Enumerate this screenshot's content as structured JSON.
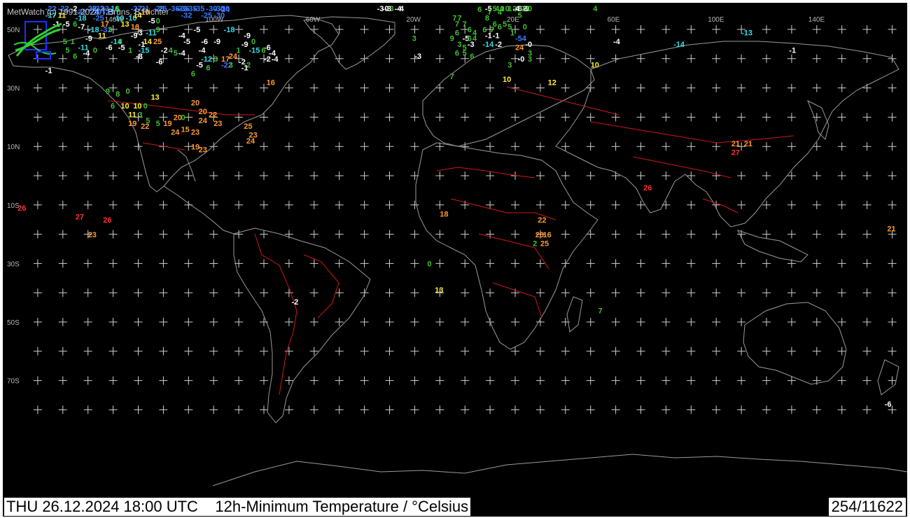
{
  "credit": "MetWatch  (c) 1991-2024 T.Bruns, B.Richter",
  "footer": {
    "left": "THU 26.12.2024 18:00 UTC    12h-Minimum Temperature / °Celsius",
    "right": "254/11622"
  },
  "lon_labels": [
    "140W",
    "100W",
    "60W",
    "20W",
    "20E",
    "60E",
    "100E",
    "140E"
  ],
  "lat_labels": [
    "50N",
    "30N",
    "10N",
    "10S",
    "30S",
    "50S",
    "70S"
  ],
  "colors": {
    "very_cold": "#3a7aff",
    "cold": "#33dde8",
    "freezing": "#ffffff",
    "cool": "#40c030",
    "mild": "#ffee33",
    "warm": "#ff9a30",
    "hot": "#ff3030"
  },
  "observations": [
    {
      "v": "-30",
      "lon": -98,
      "lat": 65
    },
    {
      "v": "-36",
      "lon": -114,
      "lat": 63
    },
    {
      "v": "-32",
      "lon": -115,
      "lat": 60
    },
    {
      "v": "-35",
      "lon": -111,
      "lat": 60
    },
    {
      "v": "-21",
      "lon": -130,
      "lat": 64
    },
    {
      "v": "-25",
      "lon": -123,
      "lat": 63
    },
    {
      "v": "-32",
      "lon": -148,
      "lat": 62
    },
    {
      "v": "-25",
      "lon": -151,
      "lat": 60
    },
    {
      "v": "-23",
      "lon": -146,
      "lat": 59
    },
    {
      "v": "-30",
      "lon": -103,
      "lat": 58
    },
    {
      "v": "-22",
      "lon": -167,
      "lat": 58
    },
    {
      "v": "-22",
      "lon": -162,
      "lat": 59
    },
    {
      "v": "-2",
      "lon": -157,
      "lat": 59
    },
    {
      "v": "-22",
      "lon": -151,
      "lat": 58
    },
    {
      "v": "-16",
      "lon": -142,
      "lat": 57
    },
    {
      "v": "-27",
      "lon": -133,
      "lat": 58
    },
    {
      "v": "-29",
      "lon": -124,
      "lat": 58
    },
    {
      "v": "-36",
      "lon": -118,
      "lat": 58
    },
    {
      "v": "-35",
      "lon": -108,
      "lat": 58
    },
    {
      "v": "-24",
      "lon": -98,
      "lat": 56
    },
    {
      "v": "-32",
      "lon": -155,
      "lat": 55
    },
    {
      "v": "-29",
      "lon": -149,
      "lat": 55
    },
    {
      "v": "-25",
      "lon": -144,
      "lat": 55
    },
    {
      "v": "5",
      "lon": -139,
      "lat": 56
    },
    {
      "v": "19",
      "lon": -129,
      "lat": 55
    },
    {
      "v": "-32",
      "lon": -113,
      "lat": 54
    },
    {
      "v": "-25",
      "lon": -105,
      "lat": 54
    },
    {
      "v": "-30",
      "lon": -100,
      "lat": 54
    },
    {
      "v": "-17",
      "lon": -167,
      "lat": 54
    },
    {
      "v": "11",
      "lon": -162,
      "lat": 54
    },
    {
      "v": "-18",
      "lon": -155,
      "lat": 53
    },
    {
      "v": "-25",
      "lon": -148,
      "lat": 53
    },
    {
      "v": "-10",
      "lon": -140,
      "lat": 53
    },
    {
      "v": "-10",
      "lon": -135,
      "lat": 53
    },
    {
      "v": "14",
      "lon": -132,
      "lat": 54
    },
    {
      "v": "-1",
      "lon": -164,
      "lat": 51
    },
    {
      "v": "-5",
      "lon": -160,
      "lat": 51
    },
    {
      "v": "6",
      "lon": -156,
      "lat": 51
    },
    {
      "v": "-7",
      "lon": -154,
      "lat": 50
    },
    {
      "v": "17",
      "lon": -145,
      "lat": 51
    },
    {
      "v": "13",
      "lon": -137,
      "lat": 51
    },
    {
      "v": "16",
      "lon": -133,
      "lat": 50
    },
    {
      "v": "-5",
      "lon": -126,
      "lat": 52
    },
    {
      "v": "0",
      "lon": -123,
      "lat": 52
    },
    {
      "v": "-18",
      "lon": -150,
      "lat": 49
    },
    {
      "v": "-31",
      "lon": -145,
      "lat": 49
    },
    {
      "v": "3",
      "lon": -142,
      "lat": 49
    },
    {
      "v": "-3",
      "lon": -131,
      "lat": 48
    },
    {
      "v": "-11",
      "lon": -127,
      "lat": 48
    },
    {
      "v": "9",
      "lon": -123,
      "lat": 49
    },
    {
      "v": "-5",
      "lon": -108,
      "lat": 49
    },
    {
      "v": "-18",
      "lon": -96,
      "lat": 49
    },
    {
      "v": "-9",
      "lon": -88,
      "lat": 47
    },
    {
      "v": "0",
      "lon": -85,
      "lat": 45
    },
    {
      "v": "-4",
      "lon": -114,
      "lat": 47
    },
    {
      "v": "5",
      "lon": -160,
      "lat": 45
    },
    {
      "v": "1",
      "lon": -157,
      "lat": 45
    },
    {
      "v": "-9",
      "lon": -151,
      "lat": 46
    },
    {
      "v": "11",
      "lon": -146,
      "lat": 47
    },
    {
      "v": "-14",
      "lon": -141,
      "lat": 45
    },
    {
      "v": "8",
      "lon": -138,
      "lat": 45
    },
    {
      "v": "-9",
      "lon": -133,
      "lat": 47
    },
    {
      "v": "14",
      "lon": -128,
      "lat": 45
    },
    {
      "v": "25",
      "lon": -124,
      "lat": 45
    },
    {
      "v": "-1",
      "lon": -130,
      "lat": 44
    },
    {
      "v": "-5",
      "lon": -112,
      "lat": 45
    },
    {
      "v": "-6",
      "lon": -105,
      "lat": 45
    },
    {
      "v": "-9",
      "lon": -100,
      "lat": 45
    },
    {
      "v": "-9",
      "lon": -89,
      "lat": 44
    },
    {
      "v": "-6",
      "lon": -80,
      "lat": 43
    },
    {
      "v": "5",
      "lon": -159,
      "lat": 42
    },
    {
      "v": "-11",
      "lon": -154,
      "lat": 43
    },
    {
      "v": "0",
      "lon": -148,
      "lat": 42
    },
    {
      "v": "-6",
      "lon": -143,
      "lat": 43
    },
    {
      "v": "-5",
      "lon": -138,
      "lat": 43
    },
    {
      "v": "1",
      "lon": -134,
      "lat": 42
    },
    {
      "v": "-15",
      "lon": -130,
      "lat": 42
    },
    {
      "v": "-2",
      "lon": -121,
      "lat": 42
    },
    {
      "v": "4",
      "lon": -118,
      "lat": 42
    },
    {
      "v": "5",
      "lon": -116,
      "lat": 41
    },
    {
      "v": "-4",
      "lon": -114,
      "lat": 41
    },
    {
      "v": "-4",
      "lon": -106,
      "lat": 42
    },
    {
      "v": "1",
      "lon": -91,
      "lat": 42
    },
    {
      "v": "-15",
      "lon": -86,
      "lat": 42
    },
    {
      "v": "6",
      "lon": -81,
      "lat": 42
    },
    {
      "v": "-4",
      "lon": -78,
      "lat": 41
    },
    {
      "v": "6",
      "lon": -156,
      "lat": 40
    },
    {
      "v": "-4",
      "lon": -152,
      "lat": 41
    },
    {
      "v": "-8",
      "lon": -131,
      "lat": 40
    },
    {
      "v": "-6",
      "lon": -123,
      "lat": 38
    },
    {
      "v": "-12",
      "lon": -105,
      "lat": 39
    },
    {
      "v": "3",
      "lon": -100,
      "lat": 39
    },
    {
      "v": "17",
      "lon": -97,
      "lat": 39
    },
    {
      "v": "24",
      "lon": -94,
      "lat": 40
    },
    {
      "v": "-2",
      "lon": -90,
      "lat": 38
    },
    {
      "v": "2",
      "lon": -87,
      "lat": 37
    },
    {
      "v": "-2",
      "lon": -80,
      "lat": 39
    },
    {
      "v": "-4",
      "lon": -77,
      "lat": 39
    },
    {
      "v": "-5",
      "lon": -107,
      "lat": 37
    },
    {
      "v": "6",
      "lon": -103,
      "lat": 36
    },
    {
      "v": "-22",
      "lon": -97,
      "lat": 37
    },
    {
      "v": "3",
      "lon": -94,
      "lat": 37
    },
    {
      "v": "-1",
      "lon": -89,
      "lat": 36
    },
    {
      "v": "6",
      "lon": -109,
      "lat": 34
    },
    {
      "v": "-1",
      "lon": -167,
      "lat": 35
    },
    {
      "v": "9",
      "lon": -143,
      "lat": 28
    },
    {
      "v": "8",
      "lon": -139,
      "lat": 27
    },
    {
      "v": "0",
      "lon": -135,
      "lat": 28
    },
    {
      "v": "13",
      "lon": -125,
      "lat": 26
    },
    {
      "v": "6",
      "lon": -141,
      "lat": 23
    },
    {
      "v": "10",
      "lon": -137,
      "lat": 23
    },
    {
      "v": "10",
      "lon": -132,
      "lat": 23
    },
    {
      "v": "0",
      "lon": -128,
      "lat": 23
    },
    {
      "v": "11",
      "lon": -134,
      "lat": 20
    },
    {
      "v": "3",
      "lon": -130,
      "lat": 20
    },
    {
      "v": "19",
      "lon": -134,
      "lat": 17
    },
    {
      "v": "5",
      "lon": -127,
      "lat": 18
    },
    {
      "v": "22",
      "lon": -129,
      "lat": 16
    },
    {
      "v": "5",
      "lon": -123,
      "lat": 17
    },
    {
      "v": "19",
      "lon": -120,
      "lat": 17
    },
    {
      "v": "20",
      "lon": -116,
      "lat": 19
    },
    {
      "v": "0",
      "lon": -113,
      "lat": 19
    },
    {
      "v": "24",
      "lon": -117,
      "lat": 14
    },
    {
      "v": "15",
      "lon": -113,
      "lat": 15
    },
    {
      "v": "23",
      "lon": -109,
      "lat": 14
    },
    {
      "v": "20",
      "lon": -109,
      "lat": 24
    },
    {
      "v": "20",
      "lon": -106,
      "lat": 21
    },
    {
      "v": "22",
      "lon": -102,
      "lat": 20
    },
    {
      "v": "24",
      "lon": -106,
      "lat": 18
    },
    {
      "v": "23",
      "lon": -100,
      "lat": 17
    },
    {
      "v": "25",
      "lon": -88,
      "lat": 16
    },
    {
      "v": "23",
      "lon": -86,
      "lat": 13
    },
    {
      "v": "24",
      "lon": -87,
      "lat": 11
    },
    {
      "v": "19",
      "lon": -109,
      "lat": 9
    },
    {
      "v": "23",
      "lon": -106,
      "lat": 8
    },
    {
      "v": "16",
      "lon": -79,
      "lat": 31
    },
    {
      "v": "26",
      "lon": -178,
      "lat": -12
    },
    {
      "v": "27",
      "lon": -155,
      "lat": -15
    },
    {
      "v": "26",
      "lon": -144,
      "lat": -16
    },
    {
      "v": "23",
      "lon": -150,
      "lat": -21
    },
    {
      "v": "-2",
      "lon": -69,
      "lat": -44
    },
    {
      "v": "-4",
      "lon": -27,
      "lat": 65
    },
    {
      "v": "-0",
      "lon": -33,
      "lat": 59
    },
    {
      "v": "3",
      "lon": -30,
      "lat": 59
    },
    {
      "v": "-4",
      "lon": -28,
      "lat": 59
    },
    {
      "v": "-3",
      "lon": -35,
      "lat": 72
    },
    {
      "v": "-3",
      "lon": -32,
      "lat": 72
    },
    {
      "v": "-2",
      "lon": 23,
      "lat": 70
    },
    {
      "v": "-6",
      "lon": 20,
      "lat": 68
    },
    {
      "v": "4",
      "lon": 51,
      "lat": 72
    },
    {
      "v": "1",
      "lon": 14,
      "lat": 63
    },
    {
      "v": "0",
      "lon": 16,
      "lat": 63
    },
    {
      "v": "-4",
      "lon": 19,
      "lat": 63
    },
    {
      "v": "-3",
      "lon": 22,
      "lat": 62
    },
    {
      "v": "3",
      "lon": 24,
      "lat": 62
    },
    {
      "v": "0",
      "lon": 25,
      "lat": 64
    },
    {
      "v": "4",
      "lon": 12,
      "lat": 60
    },
    {
      "v": "0",
      "lon": 14,
      "lat": 60
    },
    {
      "v": "1",
      "lon": 17,
      "lat": 59
    },
    {
      "v": "-0",
      "lon": 23,
      "lat": 59
    },
    {
      "v": "4",
      "lon": 24,
      "lat": 59
    },
    {
      "v": "-5",
      "lon": 8,
      "lat": 58
    },
    {
      "v": "5",
      "lon": 11,
      "lat": 58
    },
    {
      "v": "6",
      "lon": 5,
      "lat": 56
    },
    {
      "v": "7",
      "lon": 9,
      "lat": 55
    },
    {
      "v": "4",
      "lon": 13,
      "lat": 55
    },
    {
      "v": "2",
      "lon": 19,
      "lat": 57
    },
    {
      "v": "0",
      "lon": 22,
      "lat": 57
    },
    {
      "v": "5",
      "lon": 21,
      "lat": 54
    },
    {
      "v": "7",
      "lon": -5,
      "lat": 53
    },
    {
      "v": "7",
      "lon": -3,
      "lat": 53
    },
    {
      "v": "8",
      "lon": 8,
      "lat": 53
    },
    {
      "v": "6",
      "lon": 11,
      "lat": 51
    },
    {
      "v": "5",
      "lon": 15,
      "lat": 51
    },
    {
      "v": "7",
      "lon": -4,
      "lat": 51
    },
    {
      "v": "7",
      "lon": -1,
      "lat": 51
    },
    {
      "v": "6",
      "lon": 1,
      "lat": 49
    },
    {
      "v": "6",
      "lon": -4,
      "lat": 48
    },
    {
      "v": "4",
      "lon": 3,
      "lat": 48
    },
    {
      "v": "-1",
      "lon": 8,
      "lat": 47
    },
    {
      "v": "-1",
      "lon": 11,
      "lat": 47
    },
    {
      "v": "6",
      "lon": 7,
      "lat": 49
    },
    {
      "v": "7",
      "lon": 10,
      "lat": 49
    },
    {
      "v": "6",
      "lon": 13,
      "lat": 50
    },
    {
      "v": "5",
      "lon": 17,
      "lat": 50
    },
    {
      "v": "1",
      "lon": 18,
      "lat": 48
    },
    {
      "v": "0",
      "lon": 23,
      "lat": 50
    },
    {
      "v": "9",
      "lon": -6,
      "lat": 46
    },
    {
      "v": "-5",
      "lon": -1,
      "lat": 46
    },
    {
      "v": "6",
      "lon": 1,
      "lat": 46
    },
    {
      "v": "4",
      "lon": 3,
      "lat": 46
    },
    {
      "v": "-3",
      "lon": 1,
      "lat": 44
    },
    {
      "v": "3",
      "lon": -3,
      "lat": 44
    },
    {
      "v": "5",
      "lon": -1,
      "lat": 43
    },
    {
      "v": "-14",
      "lon": 7,
      "lat": 44
    },
    {
      "v": "-2",
      "lon": 12,
      "lat": 44
    },
    {
      "v": "-54",
      "lon": 20,
      "lat": 46
    },
    {
      "v": "-0",
      "lon": 24,
      "lat": 44
    },
    {
      "v": "24",
      "lon": 20,
      "lat": 43
    },
    {
      "v": "3",
      "lon": 25,
      "lat": 41
    },
    {
      "v": "6",
      "lon": -4,
      "lat": 41
    },
    {
      "v": "5",
      "lon": -1,
      "lat": 41
    },
    {
      "v": "6",
      "lon": 2,
      "lat": 40
    },
    {
      "v": "-3",
      "lon": -20,
      "lat": 40
    },
    {
      "v": "3",
      "lon": -21,
      "lat": 46
    },
    {
      "v": "-0",
      "lon": 21,
      "lat": 39
    },
    {
      "v": "3",
      "lon": 25,
      "lat": 39
    },
    {
      "v": "3",
      "lon": 17,
      "lat": 37
    },
    {
      "v": "7",
      "lon": -6,
      "lat": 33
    },
    {
      "v": "10",
      "lon": 15,
      "lat": 32
    },
    {
      "v": "12",
      "lon": 33,
      "lat": 31
    },
    {
      "v": "10",
      "lon": 50,
      "lat": 37
    },
    {
      "v": "-4",
      "lon": 59,
      "lat": 45
    },
    {
      "v": "-14",
      "lon": 83,
      "lat": 44
    },
    {
      "v": "-13",
      "lon": 110,
      "lat": 48
    },
    {
      "v": "-1",
      "lon": 129,
      "lat": 42
    },
    {
      "v": "21",
      "lon": 106,
      "lat": 10
    },
    {
      "v": "21",
      "lon": 111,
      "lat": 10
    },
    {
      "v": "27",
      "lon": 106,
      "lat": 7
    },
    {
      "v": "26",
      "lon": 71,
      "lat": -5
    },
    {
      "v": "18",
      "lon": -10,
      "lat": -14
    },
    {
      "v": "22",
      "lon": 29,
      "lat": -16
    },
    {
      "v": "20",
      "lon": 28,
      "lat": -21
    },
    {
      "v": "16",
      "lon": 31,
      "lat": -21
    },
    {
      "v": "2",
      "lon": 27,
      "lat": -24
    },
    {
      "v": "25",
      "lon": 30,
      "lat": -24
    },
    {
      "v": "0",
      "lon": -15,
      "lat": -31
    },
    {
      "v": "13",
      "lon": -12,
      "lat": -40
    },
    {
      "v": "7",
      "lon": 53,
      "lat": -47
    },
    {
      "v": "21",
      "lon": 168,
      "lat": -19
    },
    {
      "v": "-6",
      "lon": 167,
      "lat": -79
    },
    {
      "v": "-30",
      "lon": -100,
      "lat": 71
    }
  ]
}
